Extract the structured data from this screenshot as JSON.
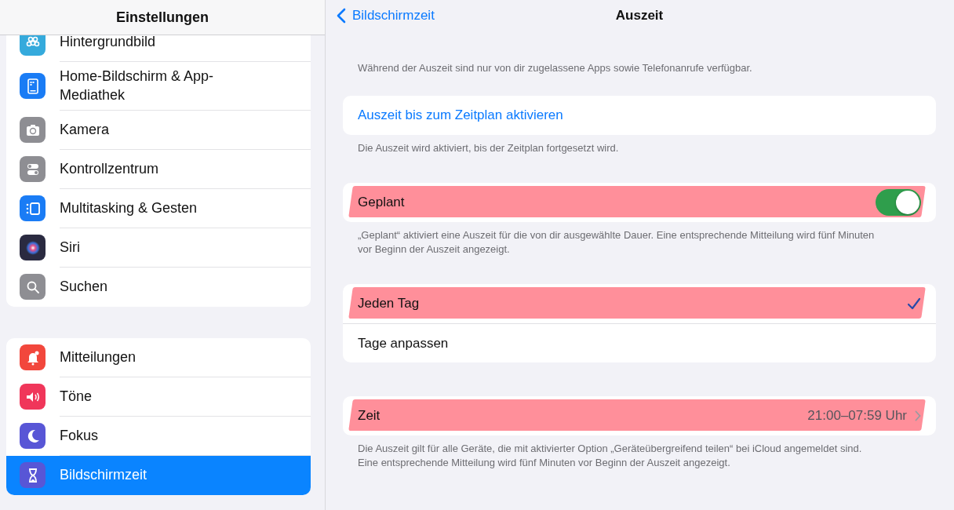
{
  "sidebar": {
    "title": "Einstellungen",
    "groups": [
      {
        "items": [
          {
            "label": "Hintergrundbild",
            "kind": "wallpaper",
            "color": "#35aadc",
            "selected": false
          },
          {
            "label": "Home-Bildschirm & App-Mediathek",
            "kind": "homescreen",
            "color": "#1a7cf5",
            "selected": false
          },
          {
            "label": "Kamera",
            "kind": "camera",
            "color": "#8e8e93",
            "selected": false
          },
          {
            "label": "Kontrollzentrum",
            "kind": "toggles",
            "color": "#8e8e93",
            "selected": false
          },
          {
            "label": "Multitasking & Gesten",
            "kind": "multitasking",
            "color": "#1a7cf5",
            "selected": false
          },
          {
            "label": "Siri",
            "kind": "siri",
            "color": "#2a2a40",
            "selected": false
          },
          {
            "label": "Suchen",
            "kind": "search",
            "color": "#8e8e93",
            "selected": false
          }
        ]
      },
      {
        "items": [
          {
            "label": "Mitteilungen",
            "kind": "bell",
            "color": "#f2473c",
            "selected": false
          },
          {
            "label": "Töne",
            "kind": "speaker",
            "color": "#f0365a",
            "selected": false
          },
          {
            "label": "Fokus",
            "kind": "moon",
            "color": "#5856d6",
            "selected": false
          },
          {
            "label": "Bildschirmzeit",
            "kind": "hourglass",
            "color": "#5856d6",
            "selected": true
          }
        ]
      }
    ]
  },
  "detail": {
    "back_label": "Bildschirmzeit",
    "title": "Auszeit",
    "intro": "Während der Auszeit sind nur von dir zugelassene Apps sowie Telefonanrufe verfügbar.",
    "sections": [
      {
        "kind": "action",
        "rows": [
          {
            "label": "Auszeit bis zum Zeitplan aktivieren"
          }
        ],
        "footer": "Die Auszeit wird aktiviert, bis der Zeitplan fortgesetzt wird."
      },
      {
        "kind": "toggle",
        "rows": [
          {
            "label": "Geplant",
            "on": true,
            "highlighted": true
          }
        ],
        "footer": "„Geplant“ aktiviert eine Auszeit für die von dir ausgewählte Dauer. Eine entsprechende Mitteilung wird fünf Minuten vor Beginn der Auszeit angezeigt."
      },
      {
        "kind": "choice",
        "rows": [
          {
            "label": "Jeden Tag",
            "selected": true,
            "highlighted": true
          },
          {
            "label": "Tage anpassen",
            "selected": false,
            "highlighted": false
          }
        ]
      },
      {
        "kind": "detail",
        "rows": [
          {
            "label": "Zeit",
            "value": "21:00–07:59 Uhr",
            "highlighted": true
          }
        ],
        "footer": "Die Auszeit gilt für alle Geräte, die mit aktivierter Option „Geräteübergreifend teilen“ bei iCloud angemeldet sind. Eine entsprechende Mitteilung wird fünf Minuten vor Beginn der Auszeit angezeigt."
      }
    ]
  }
}
